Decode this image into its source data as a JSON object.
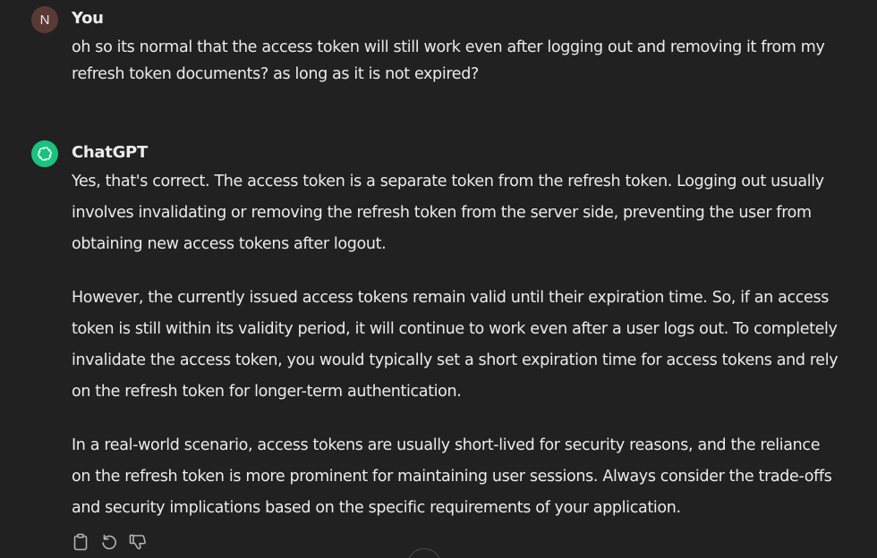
{
  "user_message": {
    "avatar_initial": "N",
    "sender": "You",
    "text": "oh so its normal that the access token will still work even after logging out and removing it from my refresh token documents? as long as it is not expired?"
  },
  "assistant_message": {
    "sender": "ChatGPT",
    "paragraphs": [
      "Yes, that's correct. The access token is a separate token from the refresh token. Logging out usually involves invalidating or removing the refresh token from the server side, preventing the user from obtaining new access tokens after logout.",
      "However, the currently issued access tokens remain valid until their expiration time. So, if an access token is still within its validity period, it will continue to work even after a user logs out. To completely invalidate the access token, you would typically set a short expiration time for access tokens and rely on the refresh token for longer-term authentication.",
      "In a real-world scenario, access tokens are usually short-lived for security reasons, and the reliance on the refresh token is more prominent for maintaining user sessions. Always consider the trade-offs and security implications based on the specific requirements of your application."
    ]
  },
  "actions": [
    {
      "icon": "clipboard-icon"
    },
    {
      "icon": "regenerate-icon"
    },
    {
      "icon": "thumbs-down-icon"
    }
  ],
  "colors": {
    "background": "#212121",
    "text": "#ececec",
    "user_avatar": "#5a3a35",
    "gpt_avatar": "#19c37d"
  }
}
